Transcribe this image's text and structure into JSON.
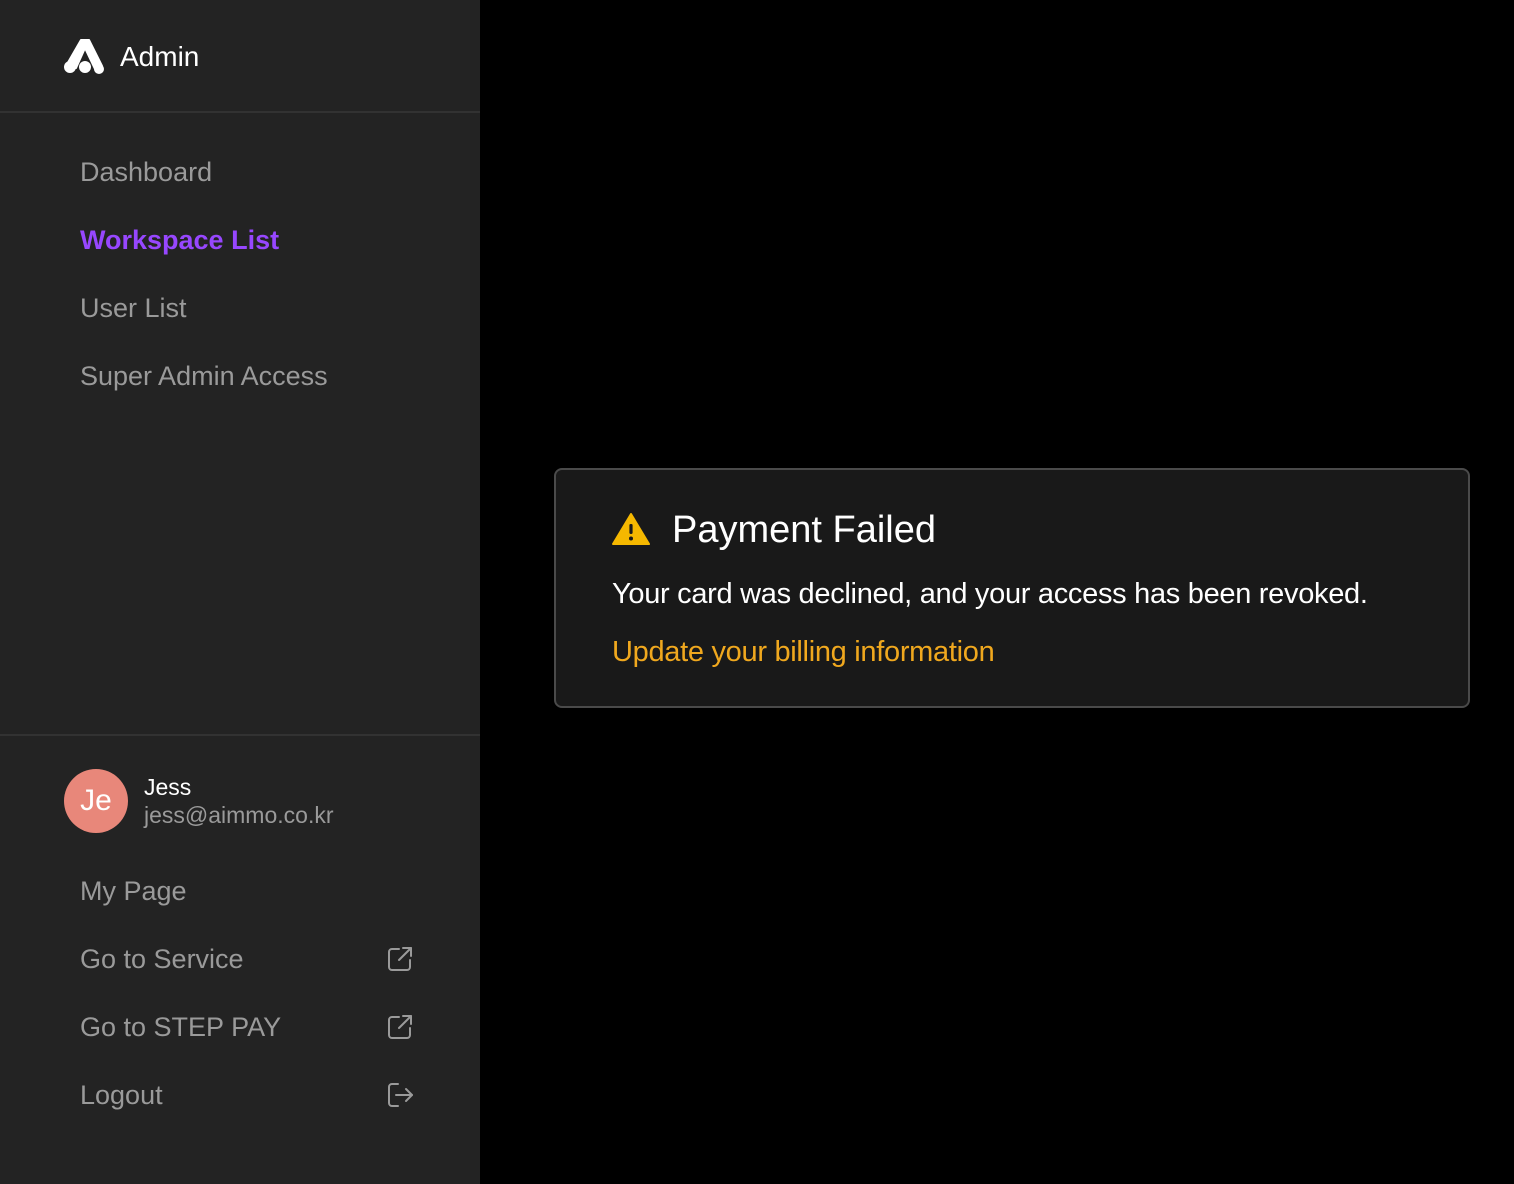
{
  "colors": {
    "active_nav": "#9747ff",
    "muted_text": "#9a9a9a",
    "avatar_bg": "#e8877a",
    "warning": "#f5b800",
    "link": "#f0a81e"
  },
  "sidebar": {
    "brand": {
      "icon": "aimmo-logo-icon",
      "title": "Admin"
    },
    "nav": [
      {
        "label": "Dashboard",
        "active": false
      },
      {
        "label": "Workspace List",
        "active": true
      },
      {
        "label": "User List",
        "active": false
      },
      {
        "label": "Super Admin Access",
        "active": false
      }
    ],
    "user": {
      "initials": "Je",
      "name": "Jess",
      "email": "jess@aimmo.co.kr"
    },
    "footer_items": [
      {
        "label": "My Page",
        "icon": ""
      },
      {
        "label": "Go to Service",
        "icon": "external-link-icon"
      },
      {
        "label": "Go to STEP PAY",
        "icon": "external-link-icon"
      },
      {
        "label": "Logout",
        "icon": "logout-icon"
      }
    ]
  },
  "alert": {
    "icon": "warning-icon",
    "title": "Payment Failed",
    "message": "Your card was declined, and your access has been revoked.",
    "link_label": "Update your billing information"
  }
}
